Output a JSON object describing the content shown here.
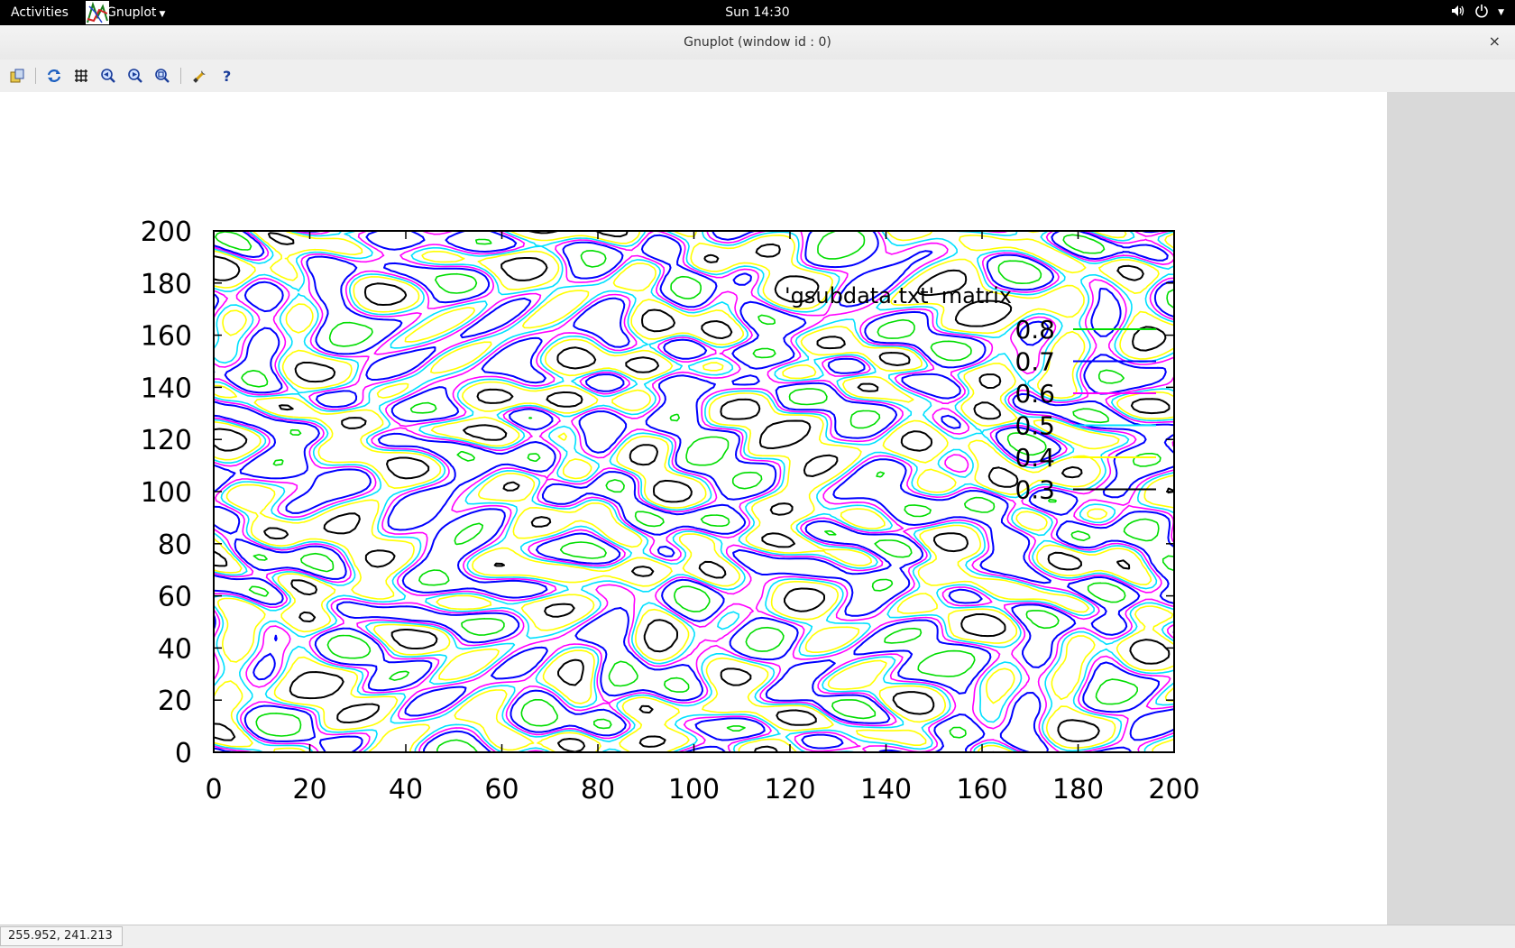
{
  "topbar": {
    "activities_label": "Activities",
    "app_name": "Gnuplot",
    "clock": "Sun 14:30"
  },
  "window": {
    "title": "Gnuplot (window id : 0)",
    "close_glyph": "×"
  },
  "toolbar": {
    "items": [
      {
        "icon": "copy-to-clipboard-icon"
      },
      {
        "icon": "replot-icon"
      },
      {
        "icon": "grid-icon"
      },
      {
        "icon": "zoom-previous-icon"
      },
      {
        "icon": "zoom-next-icon"
      },
      {
        "icon": "zoom-reset-icon"
      },
      {
        "icon": "settings-icon"
      },
      {
        "icon": "help-icon"
      }
    ]
  },
  "status": {
    "coords": "255.952,  241.213"
  },
  "colors": {
    "contour_levels": [
      "#000000",
      "#ffff00",
      "#00e0ff",
      "#ff00ff",
      "#0000ff",
      "#00dd00"
    ],
    "window_bg": "#efefef",
    "topbar_bg": "#000000"
  },
  "chart_data": {
    "type": "contour",
    "title": "",
    "xlabel": "",
    "ylabel": "",
    "xlim": [
      0,
      200
    ],
    "ylim": [
      0,
      200
    ],
    "x_ticks": [
      "0",
      "20",
      "40",
      "60",
      "80",
      "100",
      "120",
      "140",
      "160",
      "180",
      "200"
    ],
    "y_ticks": [
      "0",
      "20",
      "40",
      "60",
      "80",
      "100",
      "120",
      "140",
      "160",
      "180",
      "200"
    ],
    "grid": false,
    "legend": {
      "position": "top-right",
      "title": "'gsubdata.txt' matrix",
      "levels": [
        {
          "label": "0.8",
          "color": "#00dd00"
        },
        {
          "label": "0.7",
          "color": "#0000ff"
        },
        {
          "label": "0.6",
          "color": "#ff00ff"
        },
        {
          "label": "0.5",
          "color": "#00e0ff"
        },
        {
          "label": "0.4",
          "color": "#ffff00"
        },
        {
          "label": "0.3",
          "color": "#000000"
        }
      ]
    },
    "contour_levels": [
      0.3,
      0.4,
      0.5,
      0.6,
      0.7,
      0.8
    ]
  }
}
